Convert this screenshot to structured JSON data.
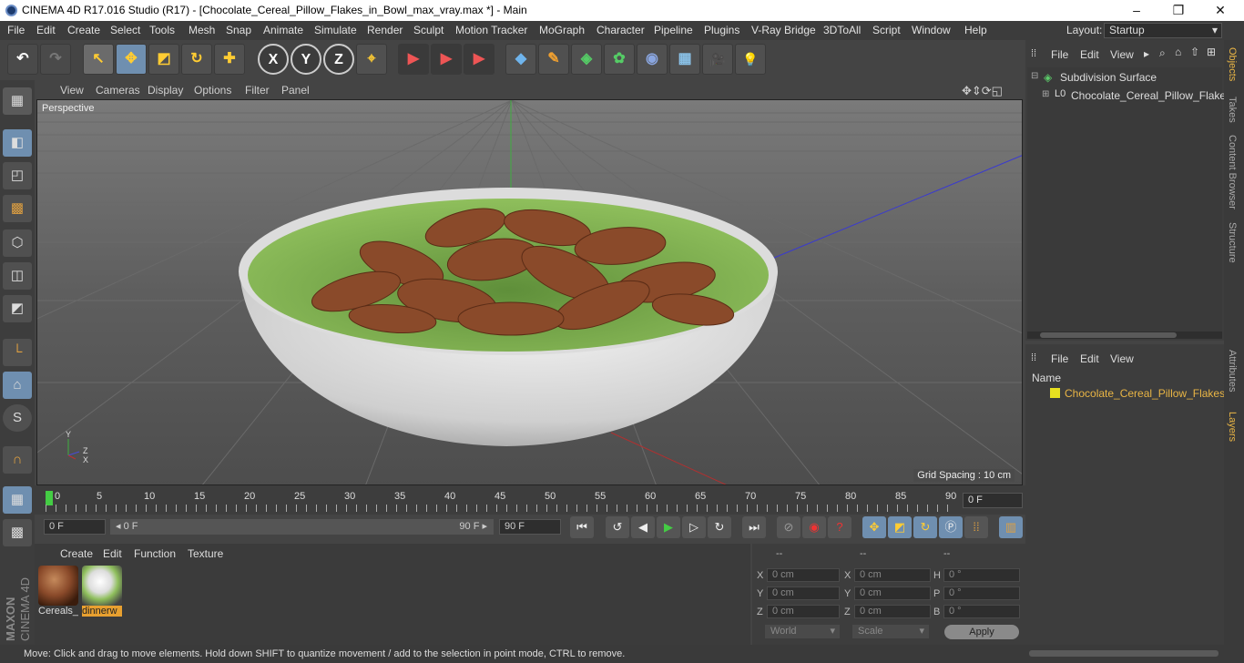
{
  "window": {
    "title": "CINEMA 4D R17.016 Studio (R17) - [Chocolate_Cereal_Pillow_Flakes_in_Bowl_max_vray.max *] - Main",
    "minimize": "–",
    "maximize": "❐",
    "close": "✕"
  },
  "menu": [
    "File",
    "Edit",
    "Create",
    "Select",
    "Tools",
    "Mesh",
    "Snap",
    "Animate",
    "Simulate",
    "Render",
    "Sculpt",
    "Motion Tracker",
    "MoGraph",
    "Character",
    "Pipeline",
    "Plugins",
    "V-Ray Bridge",
    "3DToAll",
    "Script",
    "Window",
    "Help"
  ],
  "layout": {
    "label": "Layout:",
    "value": "Startup"
  },
  "toolbar": {
    "undo": "↶",
    "redo": "↷",
    "select_tool": "↖",
    "move_tool": "✥",
    "scale_tool": "◩",
    "rotate_tool": "↻",
    "transform_tool": "✚",
    "x": "X",
    "y": "Y",
    "z": "Z",
    "coord_sys": "⌖",
    "render_view": "▶",
    "render_pic": "▶",
    "render_settings": "▶",
    "cube": "◆",
    "pen": "✎",
    "nurbs": "◈",
    "array": "✿",
    "deformer": "◉",
    "floor": "▦",
    "camera": "🎥",
    "light": "💡"
  },
  "left_tools": [
    "▦",
    "◧",
    "◰",
    "▩",
    "⬡",
    "◫",
    "◩",
    "└",
    "⌂",
    "S",
    "∩",
    "▦",
    "▩"
  ],
  "viewport": {
    "menu": [
      "View",
      "Cameras",
      "Display",
      "Options",
      "Filter",
      "Panel"
    ],
    "label": "Perspective",
    "grid_spacing": "Grid Spacing : 10 cm",
    "axis_y": "Y",
    "axis_z": "Z",
    "axis_x": "X"
  },
  "timeline": {
    "ticks": [
      "0",
      "5",
      "10",
      "15",
      "20",
      "25",
      "30",
      "35",
      "40",
      "45",
      "50",
      "55",
      "60",
      "65",
      "70",
      "75",
      "80",
      "85",
      "90"
    ],
    "current_frame": "0 F",
    "start": "0 F",
    "range_start": "◂ 0 F",
    "range_end": "90 F ▸",
    "end": "90 F"
  },
  "materials": {
    "menu": [
      "Create",
      "Edit",
      "Function",
      "Texture"
    ],
    "items": [
      {
        "label": "Cereals_"
      },
      {
        "label": "dinnerw"
      }
    ]
  },
  "coords": {
    "header": [
      "--",
      "--",
      "--"
    ],
    "rows": [
      {
        "l1": "X",
        "v1": "0 cm",
        "l2": "X",
        "v2": "0 cm",
        "l3": "H",
        "v3": "0 °"
      },
      {
        "l1": "Y",
        "v1": "0 cm",
        "l2": "Y",
        "v2": "0 cm",
        "l3": "P",
        "v3": "0 °"
      },
      {
        "l1": "Z",
        "v1": "0 cm",
        "l2": "Z",
        "v2": "0 cm",
        "l3": "B",
        "v3": "0 °"
      }
    ],
    "world": "World",
    "scale": "Scale",
    "apply": "Apply"
  },
  "status": "Move: Click and drag to move elements. Hold down SHIFT to quantize movement / add to the selection in point mode, CTRL to remove.",
  "objects": {
    "menu": [
      "File",
      "Edit",
      "View"
    ],
    "items": [
      {
        "name": "Subdivision Surface"
      },
      {
        "name": "Chocolate_Cereal_Pillow_Flakes_"
      }
    ]
  },
  "layers": {
    "menu": [
      "File",
      "Edit",
      "View"
    ],
    "header": "Name",
    "items": [
      {
        "name": "Chocolate_Cereal_Pillow_Flakes_in"
      }
    ]
  },
  "side_tabs": [
    "Objects",
    "Takes",
    "Content Browser",
    "Structure",
    "Attributes",
    "Layers"
  ],
  "maxon": {
    "brand": "MAXON",
    "product": "CINEMA 4D"
  }
}
